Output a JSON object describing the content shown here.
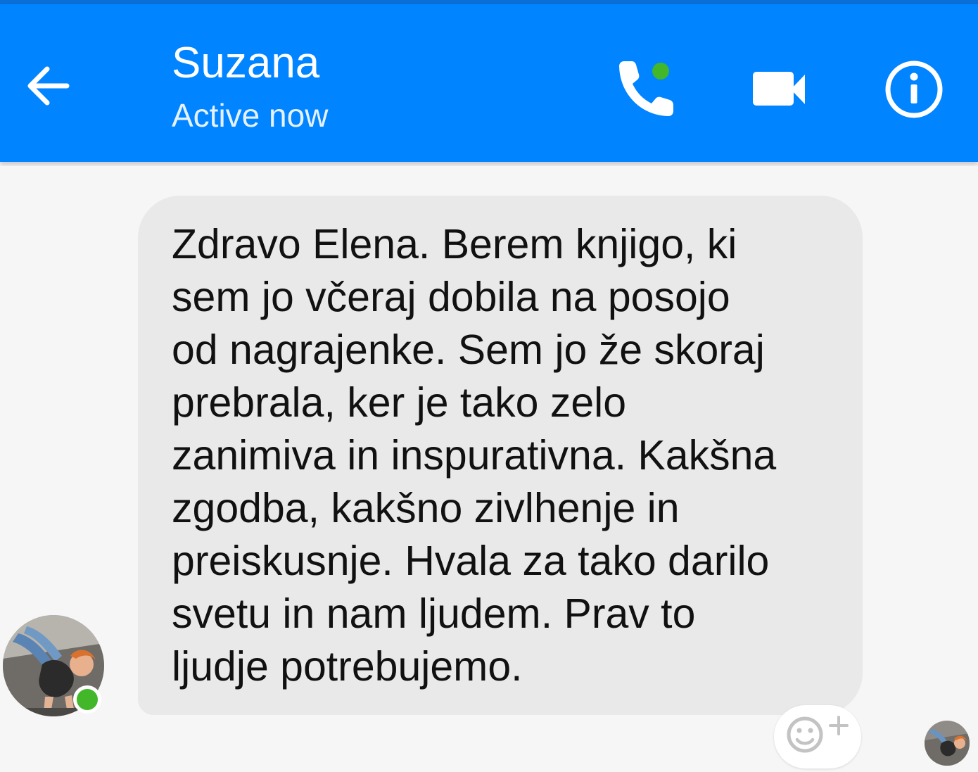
{
  "header": {
    "contact_name": "Suzana",
    "status": "Active now",
    "back_icon": "arrow-left-icon",
    "call_icon": "phone-icon",
    "video_icon": "video-camera-icon",
    "info_icon": "info-icon",
    "background_color": "#0084ff",
    "active_indicator_color": "#42b72a"
  },
  "conversation": {
    "messages": [
      {
        "sender": "Suzana",
        "text": "Zdravo Elena. Berem knjigo, ki\nsem jo včeraj dobila na posojo\nod nagrajenke. Sem jo že skoraj\nprebrala, ker je tako zelo\nzanimiva in inspurativna. Kakšna\nzgodba, kakšno zivlhenje in\npreiskusnje. Hvala za tako darilo\nsvetu in nam ljudem. Prav to\nljudje potrebujemo."
      }
    ],
    "reaction_icon": "add-reaction-icon",
    "bubble_color": "#e9e9ea"
  }
}
